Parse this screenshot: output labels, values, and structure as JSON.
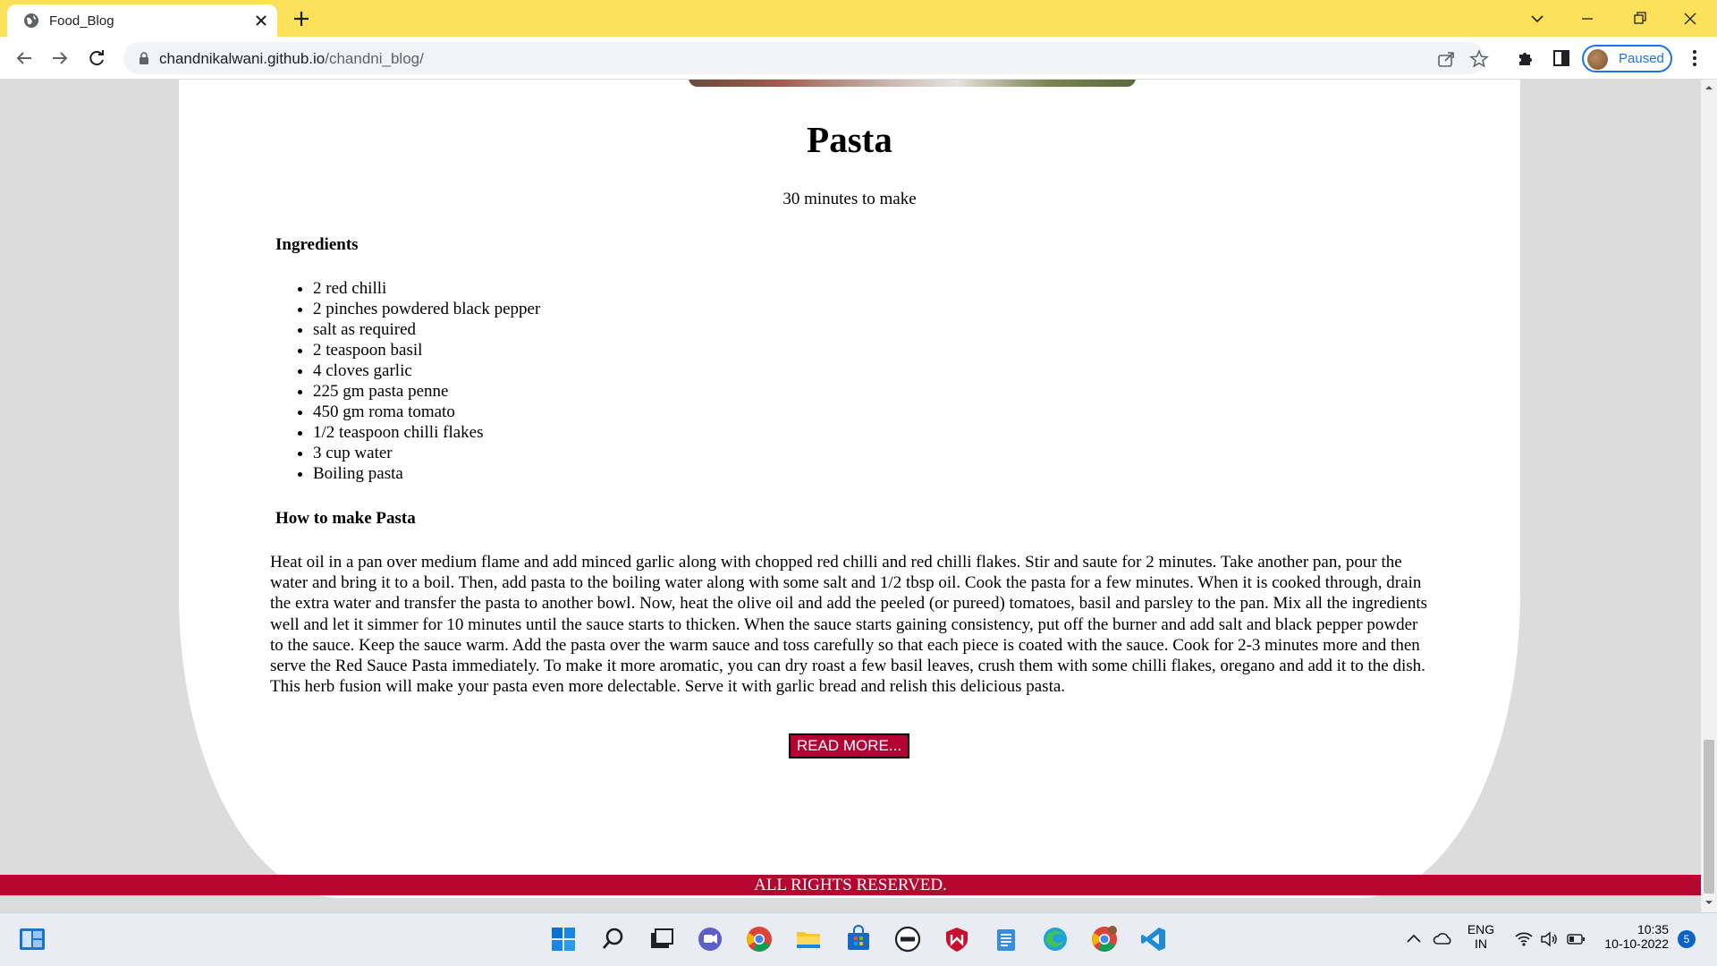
{
  "browser": {
    "tab_title": "Food_Blog",
    "url_host": "chandnikalwani.github.io",
    "url_path": "/chandni_blog/",
    "profile_label": "Paused"
  },
  "recipe": {
    "title": "Pasta",
    "time": "30 minutes to make",
    "ingredients_heading": "Ingredients",
    "ingredients": [
      "2 red chilli",
      "2 pinches powdered black pepper",
      "salt as required",
      "2 teaspoon basil",
      "4 cloves garlic",
      "225 gm pasta penne",
      "450 gm roma tomato",
      "1/2 teaspoon chilli flakes",
      "3 cup water",
      "Boiling pasta"
    ],
    "method_heading": "How to make Pasta",
    "method": "Heat oil in a pan over medium flame and add minced garlic along with chopped red chilli and red chilli flakes. Stir and saute for 2 minutes. Take another pan, pour the water and bring it to a boil. Then, add pasta to the boiling water along with some salt and 1/2 tbsp oil. Cook the pasta for a few minutes. When it is cooked through, drain the extra water and transfer the pasta to another bowl. Now, heat the olive oil and add the peeled (or pureed) tomatoes, basil and parsley to the pan. Mix all the ingredients well and let it simmer for 10 minutes until the sauce starts to thicken. When the sauce starts gaining consistency, put off the burner and add salt and black pepper powder to the sauce. Keep the sauce warm. Add the pasta over the warm sauce and toss carefully so that each piece is coated with the sauce. Cook for 2-3 minutes more and then serve the Red Sauce Pasta immediately. To make it more aromatic, you can dry roast a few basil leaves, crush them with some chilli flakes, oregano and add it to the dish. This herb fusion will make your pasta even more delectable. Serve it with garlic bread and relish this delicious pasta.",
    "read_more": "READ MORE..."
  },
  "footer": {
    "text": "ALL RIGHTS RESERVED."
  },
  "taskbar": {
    "lang_line1": "ENG",
    "lang_line2": "IN",
    "time": "10:35",
    "date": "10-10-2022",
    "notifications": "5"
  },
  "colors": {
    "tab_bar": "#fde15b",
    "accent_red": "#b5062f",
    "button_red": "#b50034",
    "page_bg": "#dcdcdc"
  }
}
